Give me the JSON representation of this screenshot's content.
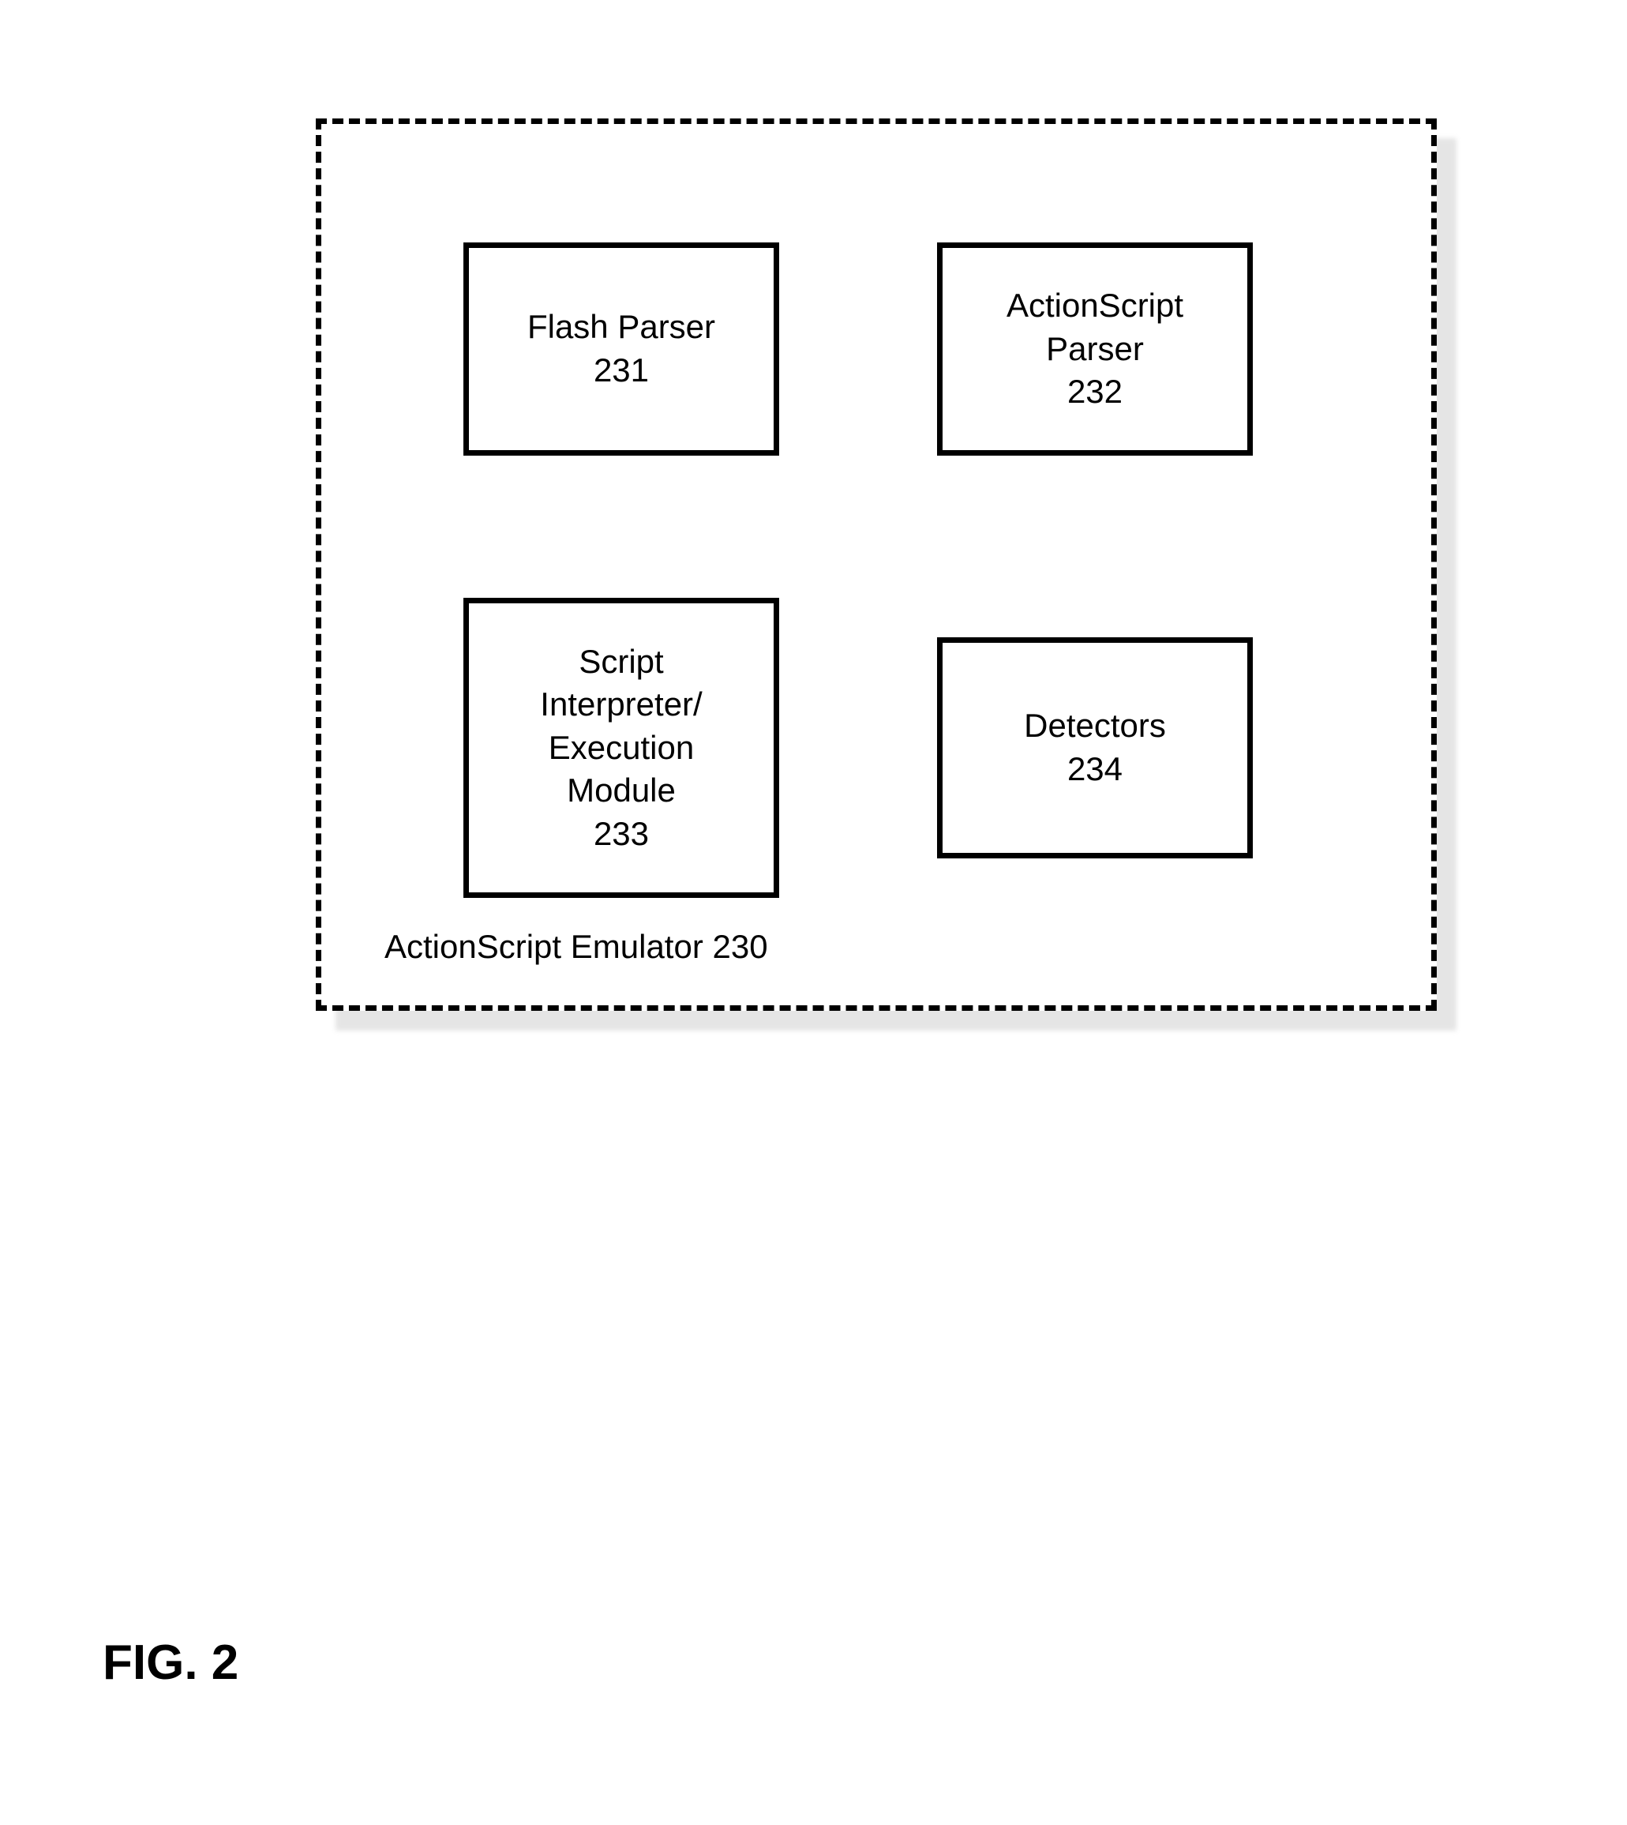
{
  "container": {
    "label": "ActionScript Emulator 230"
  },
  "boxes": {
    "flash_parser": {
      "line1": "Flash Parser",
      "line2": "231"
    },
    "actionscript_parser": {
      "line1": "ActionScript",
      "line2": "Parser",
      "line3": "232"
    },
    "script_interpreter": {
      "line1": "Script",
      "line2": "Interpreter/",
      "line3": "Execution",
      "line4": "Module",
      "line5": "233"
    },
    "detectors": {
      "line1": "Detectors",
      "line2": "234"
    }
  },
  "figure_label": "FIG. 2"
}
